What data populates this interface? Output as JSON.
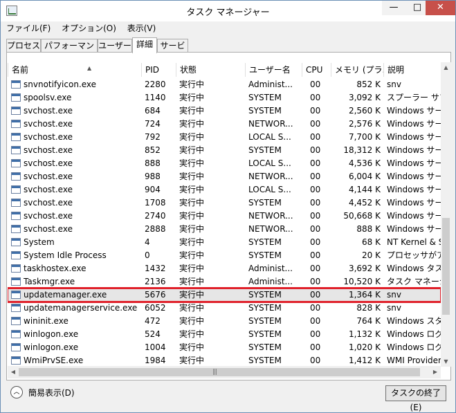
{
  "window": {
    "title": "タスク マネージャー",
    "min_glyph": "—",
    "max_glyph": "□",
    "close_glyph": "✕"
  },
  "menu": [
    "ファイル(F)",
    "オプション(O)",
    "表示(V)"
  ],
  "tabs": [
    "プロセス",
    "パフォーマンス",
    "ユーザー",
    "詳細",
    "サービス"
  ],
  "active_tab": "詳細",
  "columns": {
    "name": "名前",
    "pid": "PID",
    "status": "状態",
    "user": "ユーザー名",
    "cpu": "CPU",
    "memory": "メモリ (プラ...",
    "description": "説明"
  },
  "processes": [
    {
      "name": "snvnotifyicon.exe",
      "pid": "2280",
      "status": "実行中",
      "user": "Administ...",
      "cpu": "00",
      "memory": "852 K",
      "description": "snv"
    },
    {
      "name": "spoolsv.exe",
      "pid": "1140",
      "status": "実行中",
      "user": "SYSTEM",
      "cpu": "00",
      "memory": "3,092 K",
      "description": "スプーラー サブシ"
    },
    {
      "name": "svchost.exe",
      "pid": "684",
      "status": "実行中",
      "user": "SYSTEM",
      "cpu": "00",
      "memory": "2,560 K",
      "description": "Windows サー"
    },
    {
      "name": "svchost.exe",
      "pid": "724",
      "status": "実行中",
      "user": "NETWOR...",
      "cpu": "00",
      "memory": "2,576 K",
      "description": "Windows サー"
    },
    {
      "name": "svchost.exe",
      "pid": "792",
      "status": "実行中",
      "user": "LOCAL S...",
      "cpu": "00",
      "memory": "7,700 K",
      "description": "Windows サー"
    },
    {
      "name": "svchost.exe",
      "pid": "852",
      "status": "実行中",
      "user": "SYSTEM",
      "cpu": "00",
      "memory": "18,312 K",
      "description": "Windows サー"
    },
    {
      "name": "svchost.exe",
      "pid": "888",
      "status": "実行中",
      "user": "LOCAL S...",
      "cpu": "00",
      "memory": "4,536 K",
      "description": "Windows サー"
    },
    {
      "name": "svchost.exe",
      "pid": "988",
      "status": "実行中",
      "user": "NETWOR...",
      "cpu": "00",
      "memory": "6,004 K",
      "description": "Windows サー"
    },
    {
      "name": "svchost.exe",
      "pid": "904",
      "status": "実行中",
      "user": "LOCAL S...",
      "cpu": "00",
      "memory": "4,144 K",
      "description": "Windows サー"
    },
    {
      "name": "svchost.exe",
      "pid": "1708",
      "status": "実行中",
      "user": "SYSTEM",
      "cpu": "00",
      "memory": "4,452 K",
      "description": "Windows サー"
    },
    {
      "name": "svchost.exe",
      "pid": "2740",
      "status": "実行中",
      "user": "NETWOR...",
      "cpu": "00",
      "memory": "50,668 K",
      "description": "Windows サー"
    },
    {
      "name": "svchost.exe",
      "pid": "2888",
      "status": "実行中",
      "user": "NETWOR...",
      "cpu": "00",
      "memory": "888 K",
      "description": "Windows サー"
    },
    {
      "name": "System",
      "pid": "4",
      "status": "実行中",
      "user": "SYSTEM",
      "cpu": "00",
      "memory": "68 K",
      "description": "NT Kernel & S"
    },
    {
      "name": "System Idle Process",
      "pid": "0",
      "status": "実行中",
      "user": "SYSTEM",
      "cpu": "00",
      "memory": "20 K",
      "description": "プロセッサがアイド"
    },
    {
      "name": "taskhostex.exe",
      "pid": "1432",
      "status": "実行中",
      "user": "Administ...",
      "cpu": "00",
      "memory": "3,692 K",
      "description": "Windows タスク"
    },
    {
      "name": "Taskmgr.exe",
      "pid": "2136",
      "status": "実行中",
      "user": "Administ...",
      "cpu": "00",
      "memory": "10,520 K",
      "description": "タスク マネージャー"
    },
    {
      "name": "updatemanager.exe",
      "pid": "5676",
      "status": "実行中",
      "user": "SYSTEM",
      "cpu": "00",
      "memory": "1,364 K",
      "description": "snv",
      "highlighted": true
    },
    {
      "name": "updatemanagerservice.exe",
      "pid": "6052",
      "status": "実行中",
      "user": "SYSTEM",
      "cpu": "00",
      "memory": "828 K",
      "description": "snv"
    },
    {
      "name": "wininit.exe",
      "pid": "472",
      "status": "実行中",
      "user": "SYSTEM",
      "cpu": "00",
      "memory": "764 K",
      "description": "Windows スター"
    },
    {
      "name": "winlogon.exe",
      "pid": "524",
      "status": "実行中",
      "user": "SYSTEM",
      "cpu": "00",
      "memory": "1,132 K",
      "description": "Windows ログオ"
    },
    {
      "name": "winlogon.exe",
      "pid": "1004",
      "status": "実行中",
      "user": "SYSTEM",
      "cpu": "00",
      "memory": "1,020 K",
      "description": "Windows ログオ"
    },
    {
      "name": "WmiPrvSE.exe",
      "pid": "1984",
      "status": "実行中",
      "user": "SYSTEM",
      "cpu": "00",
      "memory": "1,412 K",
      "description": "WMI Provider"
    }
  ],
  "footer": {
    "collapse_label": "簡易表示(D)",
    "end_task_label": "タスクの終了(E)"
  },
  "colors": {
    "highlight_outline": "#e0202a",
    "close_button": "#c7504a"
  },
  "icons": [
    "app-icon",
    "process-icon",
    "chevron-up-icon",
    "scroll-arrow-up-icon",
    "scroll-arrow-down-icon",
    "scroll-arrow-left-icon",
    "scroll-arrow-right-icon"
  ]
}
